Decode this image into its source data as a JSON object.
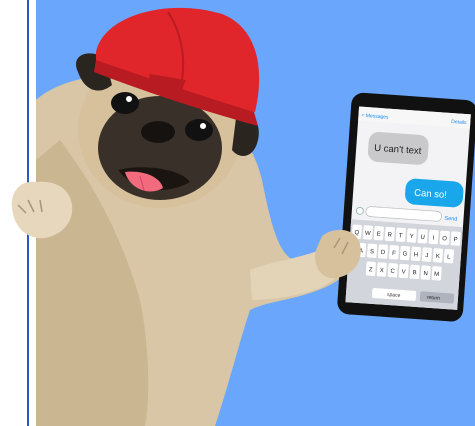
{
  "messages": {
    "left_bubble": "U can't text",
    "right_bubble": "Can so!"
  },
  "phone": {
    "back_label": "< Messages",
    "details_label": "Details",
    "send_label": "Send",
    "space_label": "space",
    "return_label": "return",
    "keyboard_rows": [
      [
        "Q",
        "W",
        "E",
        "R",
        "T",
        "Y",
        "U",
        "I",
        "O",
        "P"
      ],
      [
        "A",
        "S",
        "D",
        "F",
        "G",
        "H",
        "J",
        "K",
        "L"
      ],
      [
        "Z",
        "X",
        "C",
        "V",
        "B",
        "N",
        "M"
      ]
    ]
  },
  "colors": {
    "background": "#6aa6fb",
    "cap": "#e0262b",
    "phone_body": "#111111",
    "incoming_bubble": "#c9c9cc",
    "outgoing_bubble": "#19a6ea"
  }
}
